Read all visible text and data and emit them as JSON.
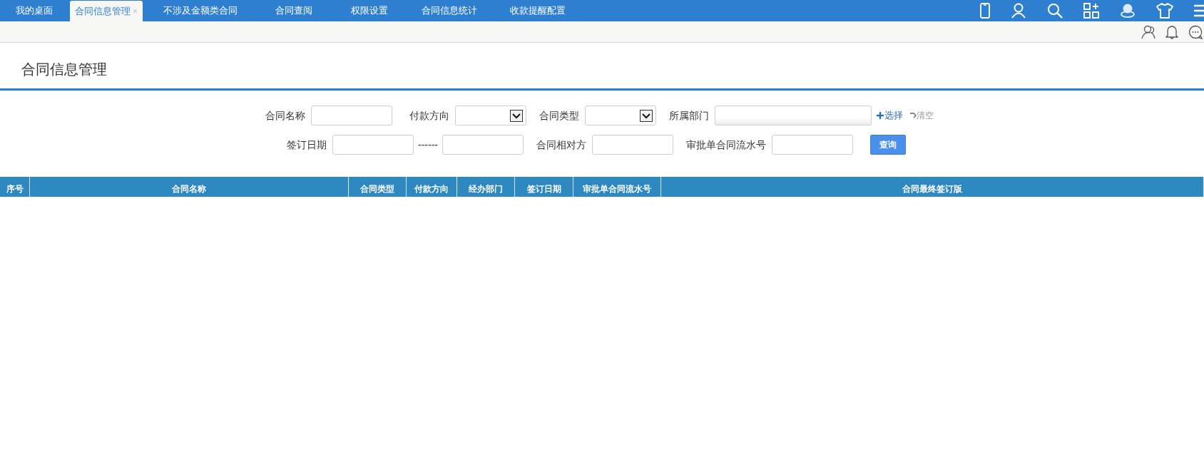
{
  "tabs": [
    {
      "label": "我的桌面",
      "selected": false
    },
    {
      "label": "合同信息管理",
      "selected": true,
      "close": "×"
    },
    {
      "label": "不涉及金额类合同",
      "selected": false
    },
    {
      "label": "合同查阅",
      "selected": false
    },
    {
      "label": "权限设置",
      "selected": false
    },
    {
      "label": "合同信息统计",
      "selected": false
    },
    {
      "label": "收款提醒配置",
      "selected": false
    }
  ],
  "page_title": "合同信息管理",
  "filters": {
    "row_1": [
      {
        "kind": "text",
        "label": "合同名称"
      },
      {
        "kind": "select",
        "label": "付款方向"
      },
      {
        "kind": "select",
        "label": "合同类型"
      },
      {
        "kind": "picker",
        "label": "所属部门",
        "choose": "选择",
        "clear": "清空"
      }
    ],
    "row_2": [
      {
        "kind": "range",
        "label": "签订日期",
        "separator": "------"
      },
      {
        "kind": "text",
        "label": "合同相对方"
      },
      {
        "kind": "text",
        "label": "审批单合同流水号"
      },
      {
        "kind": "button",
        "label": "查询"
      }
    ]
  },
  "table": {
    "columns": [
      "序号",
      "合同名称",
      "合同类型",
      "付款方向",
      "经办部门",
      "签订日期",
      "审批单合同流水号",
      "合同最终签订版"
    ]
  }
}
